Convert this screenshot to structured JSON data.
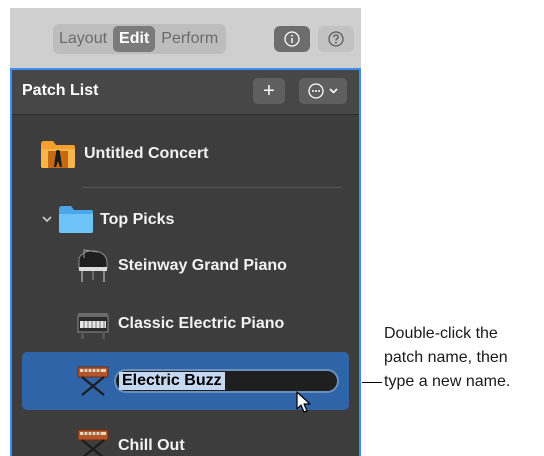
{
  "modes": {
    "layout": "Layout",
    "edit": "Edit",
    "perform": "Perform",
    "active": "Edit"
  },
  "panel": {
    "title": "Patch List",
    "add_button": "+",
    "items": [
      {
        "label": "Untitled Concert",
        "icon": "concert-folder-icon",
        "type": "concert"
      },
      {
        "label": "Top Picks",
        "icon": "folder-icon",
        "type": "set",
        "expanded": true
      },
      {
        "label": "Steinway Grand Piano",
        "icon": "grand-piano-icon",
        "type": "patch"
      },
      {
        "label": "Classic Electric Piano",
        "icon": "electric-piano-icon",
        "type": "patch"
      },
      {
        "label": "Electric Buzz",
        "icon": "synthesizer-icon",
        "type": "patch",
        "selected": true,
        "editing": true
      },
      {
        "label": "Chill Out",
        "icon": "synthesizer-icon",
        "type": "patch"
      }
    ]
  },
  "callout": {
    "lines": [
      "Double-click the",
      "patch name, then",
      "type a new name."
    ]
  },
  "colors": {
    "accent": "#3b8ff5",
    "selection": "#2f64a9",
    "panel": "#3d3d3d",
    "toolbar": "#cfcfcf"
  }
}
